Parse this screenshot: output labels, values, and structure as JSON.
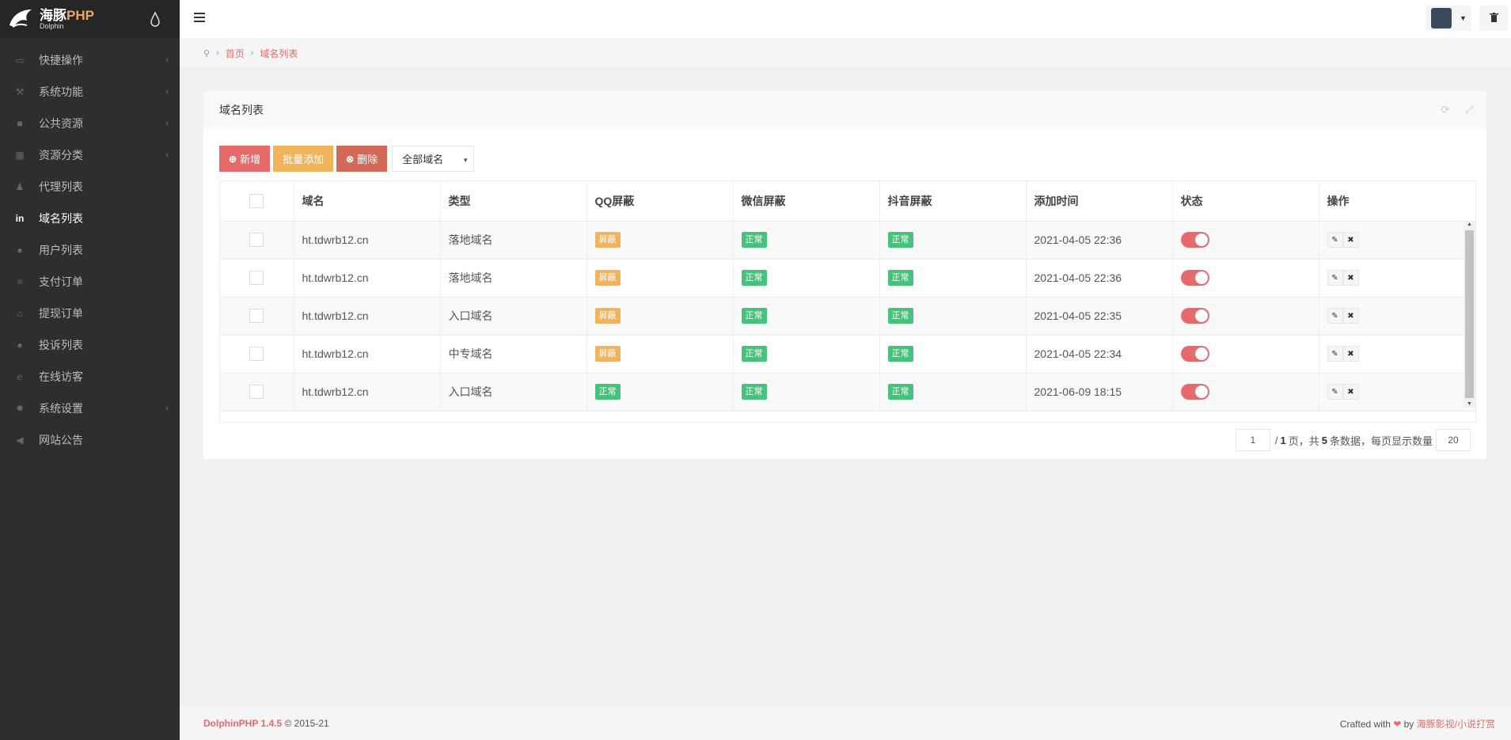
{
  "brand": {
    "name_cn": "海豚",
    "name_php": "PHP",
    "subtitle": "Dolphin"
  },
  "sidebar": {
    "items": [
      {
        "label": "快捷操作",
        "icon": "folder-open-icon",
        "glyph": "▭",
        "chevron": true,
        "active": false
      },
      {
        "label": "系统功能",
        "icon": "wrench-icon",
        "glyph": "⚒",
        "chevron": true,
        "active": false
      },
      {
        "label": "公共资源",
        "icon": "video-camera-icon",
        "glyph": "■",
        "chevron": true,
        "active": false
      },
      {
        "label": "资源分类",
        "icon": "grid-icon",
        "glyph": "▦",
        "chevron": true,
        "active": false
      },
      {
        "label": "代理列表",
        "icon": "users-icon",
        "glyph": "♟",
        "chevron": false,
        "active": false
      },
      {
        "label": "域名列表",
        "icon": "linkedin-icon",
        "glyph": "in",
        "chevron": false,
        "active": true
      },
      {
        "label": "用户列表",
        "icon": "user-icon",
        "glyph": "●",
        "chevron": false,
        "active": false
      },
      {
        "label": "支付订单",
        "icon": "database-icon",
        "glyph": "≡",
        "chevron": false,
        "active": false
      },
      {
        "label": "提现订单",
        "icon": "bank-icon",
        "glyph": "⌂",
        "chevron": false,
        "active": false
      },
      {
        "label": "投诉列表",
        "icon": "info-icon",
        "glyph": "●",
        "chevron": false,
        "active": false
      },
      {
        "label": "在线访客",
        "icon": "edge-icon",
        "glyph": "e",
        "chevron": false,
        "active": false
      },
      {
        "label": "系统设置",
        "icon": "gear-icon",
        "glyph": "✹",
        "chevron": true,
        "active": false
      },
      {
        "label": "网站公告",
        "icon": "bullhorn-icon",
        "glyph": "◀",
        "chevron": false,
        "active": false
      }
    ]
  },
  "breadcrumb": {
    "home": "首页",
    "current": "域名列表"
  },
  "panel": {
    "title": "域名列表"
  },
  "toolbar": {
    "add_label": "新增",
    "batch_label": "批量添加",
    "delete_label": "删除",
    "filter_value": "全部域名"
  },
  "table": {
    "headers": [
      "域名",
      "类型",
      "QQ屏蔽",
      "微信屏蔽",
      "抖音屏蔽",
      "添加时间",
      "状态",
      "操作"
    ],
    "rows": [
      {
        "domain": "ht.tdwrb12.cn",
        "type": "落地域名",
        "qq": "屏蔽",
        "qq_status": "warn",
        "wechat": "正常",
        "douyin": "正常",
        "time": "2021-04-05 22:36"
      },
      {
        "domain": "ht.tdwrb12.cn",
        "type": "落地域名",
        "qq": "屏蔽",
        "qq_status": "warn",
        "wechat": "正常",
        "douyin": "正常",
        "time": "2021-04-05 22:36"
      },
      {
        "domain": "ht.tdwrb12.cn",
        "type": "入口域名",
        "qq": "屏蔽",
        "qq_status": "warn",
        "wechat": "正常",
        "douyin": "正常",
        "time": "2021-04-05 22:35"
      },
      {
        "domain": "ht.tdwrb12.cn",
        "type": "中专域名",
        "qq": "屏蔽",
        "qq_status": "warn",
        "wechat": "正常",
        "douyin": "正常",
        "time": "2021-04-05 22:34"
      },
      {
        "domain": "ht.tdwrb12.cn",
        "type": "入口域名",
        "qq": "正常",
        "qq_status": "ok",
        "wechat": "正常",
        "douyin": "正常",
        "time": "2021-06-09 18:15"
      }
    ]
  },
  "pager": {
    "current_page": "1",
    "total_pages": "1",
    "text_page": "页，共",
    "total_count": "5",
    "text_count": "条数据，每页显示数量",
    "per_page": "20"
  },
  "footer": {
    "product": "DolphinPHP 1.4.5",
    "copyright": "© 2015-21",
    "crafted": "Crafted with",
    "by": "by",
    "link": "海豚影视/小说打赏"
  },
  "colors": {
    "accent": "#e76a6a",
    "warning": "#f0b45c",
    "success": "#46c37b",
    "sidebar": "#2e2e2e"
  }
}
